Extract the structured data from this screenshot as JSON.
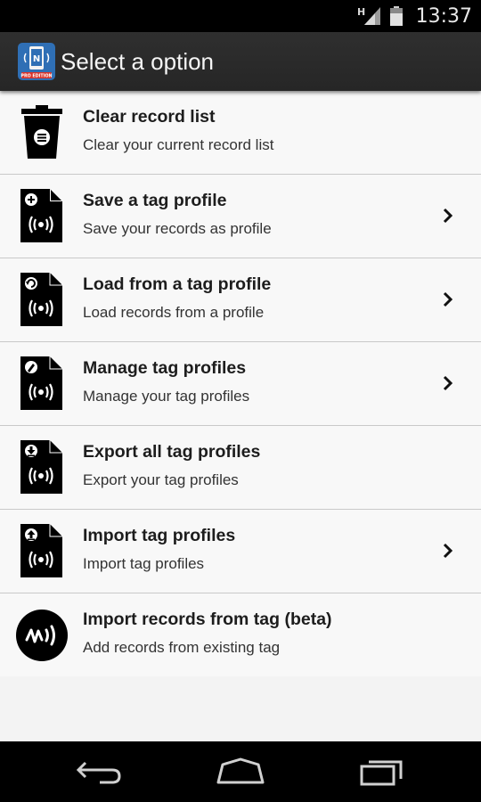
{
  "status": {
    "time": "13:37",
    "network": "H",
    "icons": [
      "signal-icon",
      "battery-icon"
    ]
  },
  "actionbar": {
    "title": "Select a option",
    "app_icon": "nfc-pro-app-icon",
    "app_icon_text": "PRO EDITION"
  },
  "items": [
    {
      "title": "Clear record list",
      "subtitle": "Clear your current record list",
      "icon": "trash-icon",
      "has_chevron": false
    },
    {
      "title": "Save a tag profile",
      "subtitle": "Save your records as profile",
      "icon": "tag-save-icon",
      "has_chevron": true
    },
    {
      "title": "Load from a tag profile",
      "subtitle": "Load records from a profile",
      "icon": "tag-load-icon",
      "has_chevron": true
    },
    {
      "title": "Manage tag profiles",
      "subtitle": "Manage your tag profiles",
      "icon": "tag-edit-icon",
      "has_chevron": true
    },
    {
      "title": "Export all tag profiles",
      "subtitle": "Export your tag profiles",
      "icon": "tag-export-icon",
      "has_chevron": false
    },
    {
      "title": "Import tag profiles",
      "subtitle": "Import tag profiles",
      "icon": "tag-import-icon",
      "has_chevron": true
    },
    {
      "title": "Import records from tag (beta)",
      "subtitle": "Add records from existing tag",
      "icon": "nfc-read-icon",
      "has_chevron": false
    }
  ],
  "navbar": {
    "buttons": [
      "back-icon",
      "home-icon",
      "recents-icon"
    ]
  },
  "colors": {
    "statusbar": "#000000",
    "actionbar": "#2b2b2b",
    "list_bg": "#f8f8f8",
    "divider": "#c9c9c9",
    "badge_red": "#d9342b",
    "app_icon_blue": "#2f6fb5"
  }
}
